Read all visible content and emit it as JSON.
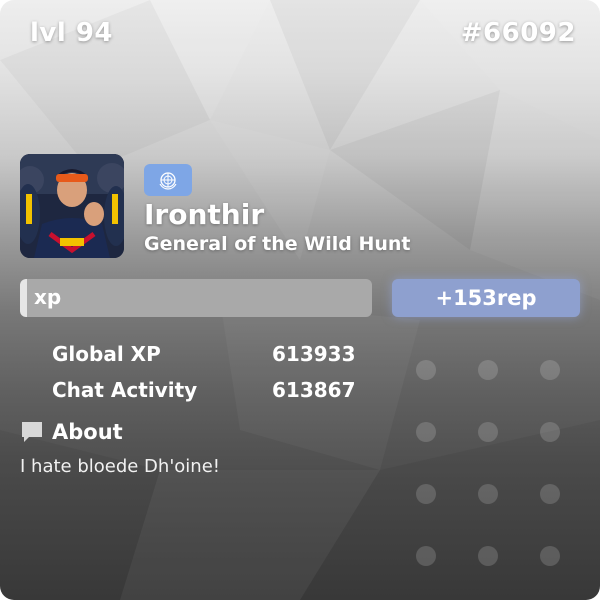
{
  "header": {
    "level": "lvl 94",
    "rank": "#66092"
  },
  "profile": {
    "username": "Ironthir",
    "title": "General of the Wild Hunt",
    "flag_icon": "un-flag-icon",
    "flag_color": "#7ea6e6"
  },
  "xp_bar": {
    "label": "xp",
    "progress_fraction": 0.02
  },
  "rep": {
    "label": "+153rep",
    "color": "#8ea0cf"
  },
  "stats": [
    {
      "label": "Global XP",
      "value": "613933"
    },
    {
      "label": "Chat Activity",
      "value": "613867"
    }
  ],
  "about": {
    "icon": "speech-bubble-icon",
    "title": "About",
    "text": "I hate bloede Dh'oine!"
  }
}
